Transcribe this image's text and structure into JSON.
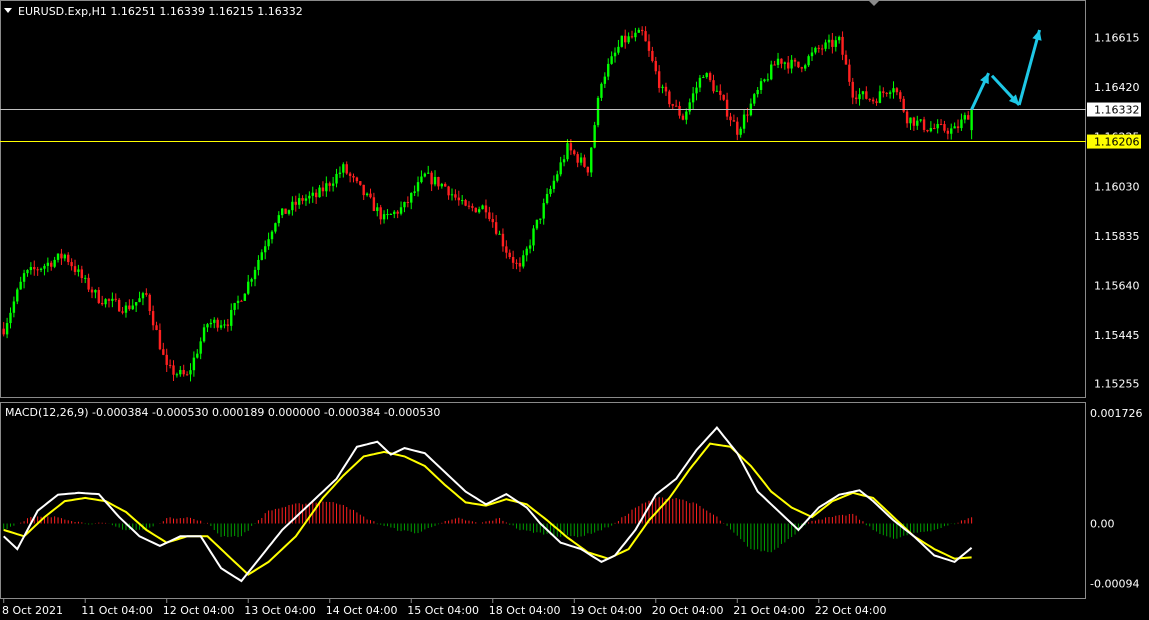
{
  "header": {
    "symbol_line": "EURUSD.Exp,H1  1.16251 1.16339 1.16215 1.16332",
    "macd_line": "MACD(12,26,9) -0.000384 -0.000530 0.000189 0.000000 -0.000384 -0.000530"
  },
  "colors": {
    "background": "#000000",
    "bull": "#00ff00",
    "bear": "#ff2020",
    "grid": "#ffffff",
    "macd_line": "#ffffff",
    "signal_line": "#ffff00",
    "hist_pos": "#ff2020",
    "hist_neg": "#00a000",
    "arrow": "#1ec8e6",
    "bid_line": "#c0c0c0",
    "ask_line": "#ffff00"
  },
  "chart_data": [
    {
      "type": "candlestick",
      "symbol": "EURUSD.Exp",
      "timeframe": "H1",
      "ohlc_last": {
        "open": 1.16251,
        "high": 1.16339,
        "low": 1.16215,
        "close": 1.16332
      },
      "y_ticks": [
        "1.16615",
        "1.16420",
        "1.16225",
        "1.16030",
        "1.15835",
        "1.15640",
        "1.15445",
        "1.15255"
      ],
      "y_ticks_values": [
        1.16615,
        1.1642,
        1.16225,
        1.1603,
        1.15835,
        1.1564,
        1.15445,
        1.15255
      ],
      "ylim": [
        1.15205,
        1.16755
      ],
      "x_ticks": [
        "8 Oct 2021",
        "11 Oct 04:00",
        "12 Oct 04:00",
        "13 Oct 04:00",
        "14 Oct 04:00",
        "15 Oct 04:00",
        "18 Oct 04:00",
        "19 Oct 04:00",
        "20 Oct 04:00",
        "21 Oct 04:00",
        "22 Oct 04:00"
      ],
      "price_tags": [
        {
          "label": "1.16332",
          "value": 1.16332,
          "style": "bid"
        },
        {
          "label": "1.16206",
          "value": 1.16206,
          "style": "ask"
        }
      ],
      "key_path": [
        [
          0,
          1.1547
        ],
        [
          6,
          1.1568
        ],
        [
          12,
          1.1572
        ],
        [
          18,
          1.1576
        ],
        [
          24,
          1.1565
        ],
        [
          28,
          1.1559
        ],
        [
          36,
          1.1555
        ],
        [
          42,
          1.156
        ],
        [
          48,
          1.1531
        ],
        [
          54,
          1.1528
        ],
        [
          60,
          1.1549
        ],
        [
          66,
          1.155
        ],
        [
          72,
          1.1565
        ],
        [
          80,
          1.159
        ],
        [
          88,
          1.1598
        ],
        [
          92,
          1.1599
        ],
        [
          100,
          1.161
        ],
        [
          106,
          1.16
        ],
        [
          112,
          1.159
        ],
        [
          118,
          1.1595
        ],
        [
          124,
          1.1607
        ],
        [
          130,
          1.1603
        ],
        [
          136,
          1.1594
        ],
        [
          142,
          1.1595
        ],
        [
          148,
          1.1578
        ],
        [
          152,
          1.157
        ],
        [
          156,
          1.1585
        ],
        [
          162,
          1.1605
        ],
        [
          166,
          1.1618
        ],
        [
          172,
          1.161
        ],
        [
          176,
          1.1645
        ],
        [
          182,
          1.166
        ],
        [
          188,
          1.1663
        ],
        [
          194,
          1.164
        ],
        [
          200,
          1.163
        ],
        [
          206,
          1.1648
        ],
        [
          210,
          1.164
        ],
        [
          216,
          1.1625
        ],
        [
          222,
          1.164
        ],
        [
          228,
          1.1653
        ],
        [
          234,
          1.165
        ],
        [
          240,
          1.1657
        ],
        [
          246,
          1.166
        ],
        [
          250,
          1.164
        ],
        [
          256,
          1.1637
        ],
        [
          262,
          1.1643
        ],
        [
          266,
          1.163
        ],
        [
          272,
          1.1626
        ],
        [
          280,
          1.1625
        ],
        [
          285,
          1.1633
        ]
      ],
      "forecast_arrows": [
        {
          "from": [
            285,
            1.16332
          ],
          "to": [
            290,
            1.16475
          ]
        },
        {
          "from": [
            291,
            1.16465
          ],
          "to": [
            299,
            1.1635
          ]
        },
        {
          "from": [
            299,
            1.1635
          ],
          "to": [
            305,
            1.16645
          ]
        }
      ],
      "horizontal_lines": [
        1.16332,
        1.16206
      ]
    },
    {
      "type": "line+histogram",
      "name": "MACD(12,26,9)",
      "values_last": {
        "macd": -0.000384,
        "signal": -0.00053
      },
      "y_ticks": [
        "0.001726",
        "0.00",
        "-0.00094"
      ],
      "y_ticks_values": [
        0.001726,
        0.0,
        -0.00094
      ],
      "ylim": [
        -0.00115,
        0.00187
      ],
      "macd_path": [
        [
          0,
          -0.0002
        ],
        [
          4,
          -0.0004
        ],
        [
          10,
          0.0002
        ],
        [
          16,
          0.00045
        ],
        [
          22,
          0.00048
        ],
        [
          28,
          0.00046
        ],
        [
          34,
          0.0001
        ],
        [
          40,
          -0.0002
        ],
        [
          46,
          -0.00035
        ],
        [
          52,
          -0.0002
        ],
        [
          58,
          -0.0002
        ],
        [
          64,
          -0.0007
        ],
        [
          70,
          -0.0009
        ],
        [
          76,
          -0.0005
        ],
        [
          82,
          -0.0001
        ],
        [
          90,
          0.0003
        ],
        [
          98,
          0.0007
        ],
        [
          104,
          0.0012
        ],
        [
          110,
          0.00128
        ],
        [
          114,
          0.00108
        ],
        [
          118,
          0.00118
        ],
        [
          124,
          0.0011
        ],
        [
          130,
          0.0008
        ],
        [
          136,
          0.0005
        ],
        [
          142,
          0.0003
        ],
        [
          148,
          0.00046
        ],
        [
          154,
          0.00025
        ],
        [
          158,
          0.0
        ],
        [
          164,
          -0.0003
        ],
        [
          170,
          -0.0004
        ],
        [
          176,
          -0.0006
        ],
        [
          180,
          -0.0005
        ],
        [
          186,
          -0.0001
        ],
        [
          192,
          0.00045
        ],
        [
          198,
          0.0007
        ],
        [
          204,
          0.00115
        ],
        [
          210,
          0.0015
        ],
        [
          216,
          0.0011
        ],
        [
          222,
          0.0005
        ],
        [
          228,
          0.0002
        ],
        [
          234,
          -0.0001
        ],
        [
          240,
          0.00025
        ],
        [
          246,
          0.00045
        ],
        [
          252,
          0.00052
        ],
        [
          256,
          0.00035
        ],
        [
          262,
          5e-05
        ],
        [
          268,
          -0.0002
        ],
        [
          274,
          -0.0005
        ],
        [
          280,
          -0.0006
        ],
        [
          285,
          -0.00038
        ]
      ],
      "signal_path": [
        [
          0,
          -0.0001
        ],
        [
          6,
          -0.0002
        ],
        [
          12,
          0.0001
        ],
        [
          18,
          0.00035
        ],
        [
          24,
          0.0004
        ],
        [
          30,
          0.00035
        ],
        [
          36,
          0.00018
        ],
        [
          42,
          -0.0001
        ],
        [
          48,
          -0.0003
        ],
        [
          54,
          -0.0002
        ],
        [
          60,
          -0.0002
        ],
        [
          66,
          -0.0005
        ],
        [
          72,
          -0.0008
        ],
        [
          78,
          -0.0006
        ],
        [
          86,
          -0.0002
        ],
        [
          94,
          0.0004
        ],
        [
          100,
          0.00075
        ],
        [
          106,
          0.00105
        ],
        [
          112,
          0.00112
        ],
        [
          118,
          0.00105
        ],
        [
          124,
          0.0009
        ],
        [
          130,
          0.0006
        ],
        [
          136,
          0.00033
        ],
        [
          142,
          0.00028
        ],
        [
          148,
          0.00038
        ],
        [
          154,
          0.0003
        ],
        [
          160,
          5e-05
        ],
        [
          166,
          -0.00022
        ],
        [
          172,
          -0.00045
        ],
        [
          178,
          -0.00055
        ],
        [
          184,
          -0.0004
        ],
        [
          190,
          5e-05
        ],
        [
          196,
          0.0004
        ],
        [
          202,
          0.00085
        ],
        [
          208,
          0.00125
        ],
        [
          214,
          0.0012
        ],
        [
          220,
          0.0009
        ],
        [
          226,
          0.0005
        ],
        [
          232,
          0.00025
        ],
        [
          238,
          0.0001
        ],
        [
          244,
          0.00035
        ],
        [
          250,
          0.00048
        ],
        [
          256,
          0.0004
        ],
        [
          262,
          0.0001
        ],
        [
          268,
          -0.0002
        ],
        [
          274,
          -0.0004
        ],
        [
          280,
          -0.00055
        ],
        [
          285,
          -0.00053
        ]
      ],
      "histogram_path": [
        [
          0,
          -0.0001
        ],
        [
          8,
          0.0001
        ],
        [
          16,
          0.0001
        ],
        [
          24,
          0.0
        ],
        [
          30,
          0.0
        ],
        [
          36,
          -0.0001
        ],
        [
          42,
          -0.0001
        ],
        [
          48,
          8e-05
        ],
        [
          54,
          0.0001
        ],
        [
          60,
          0.0
        ],
        [
          64,
          -0.0002
        ],
        [
          70,
          -0.0002
        ],
        [
          78,
          0.0002
        ],
        [
          86,
          0.0003
        ],
        [
          94,
          0.00035
        ],
        [
          100,
          0.0003
        ],
        [
          106,
          0.0001
        ],
        [
          110,
          0.0
        ],
        [
          116,
          -0.0001
        ],
        [
          122,
          -0.00015
        ],
        [
          128,
          0.0
        ],
        [
          134,
          8e-05
        ],
        [
          140,
          0.0
        ],
        [
          146,
          8e-05
        ],
        [
          152,
          -0.0001
        ],
        [
          158,
          -0.00015
        ],
        [
          164,
          -0.0002
        ],
        [
          170,
          -0.0002
        ],
        [
          176,
          -0.0001
        ],
        [
          180,
          0.0
        ],
        [
          186,
          0.00025
        ],
        [
          192,
          0.0004
        ],
        [
          198,
          0.0004
        ],
        [
          204,
          0.0003
        ],
        [
          210,
          0.0001
        ],
        [
          214,
          -0.0001
        ],
        [
          220,
          -0.0004
        ],
        [
          226,
          -0.00045
        ],
        [
          232,
          -0.0002
        ],
        [
          238,
          5e-05
        ],
        [
          244,
          0.0001
        ],
        [
          250,
          0.00015
        ],
        [
          256,
          -0.0001
        ],
        [
          262,
          -0.00025
        ],
        [
          268,
          -0.00015
        ],
        [
          274,
          -0.0001
        ],
        [
          280,
          0.0
        ],
        [
          285,
          0.0001
        ]
      ]
    }
  ]
}
